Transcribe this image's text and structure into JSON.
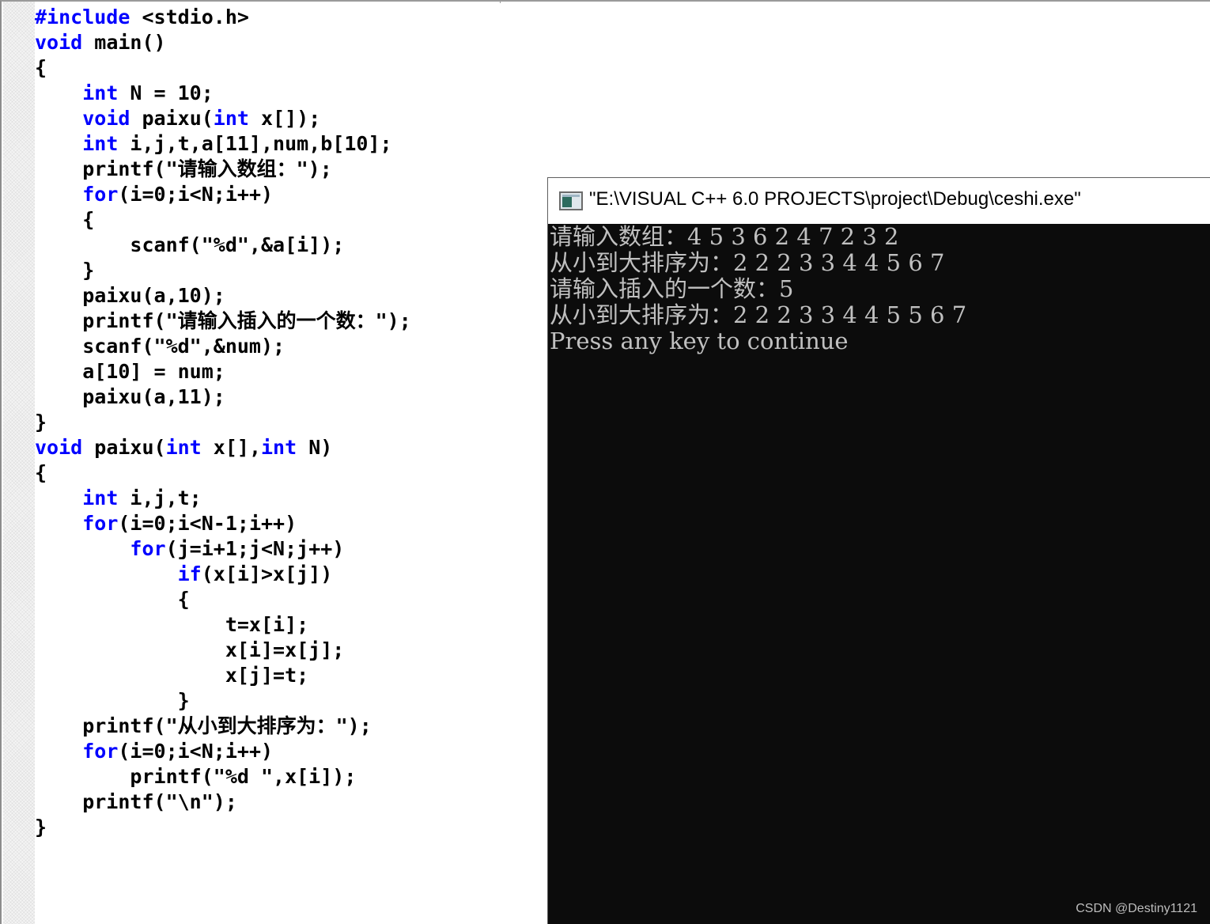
{
  "editor": {
    "code_lines": [
      [
        {
          "t": "#include",
          "k": 1
        },
        {
          "t": " <stdio.h>"
        }
      ],
      [
        {
          "t": "void",
          "k": 1
        },
        {
          "t": " main()"
        }
      ],
      [
        {
          "t": "{"
        }
      ],
      [
        {
          "t": "    "
        },
        {
          "t": "int",
          "k": 1
        },
        {
          "t": " N = 10;"
        }
      ],
      [
        {
          "t": "    "
        },
        {
          "t": "void",
          "k": 1
        },
        {
          "t": " paixu("
        },
        {
          "t": "int",
          "k": 1
        },
        {
          "t": " x[]);"
        }
      ],
      [
        {
          "t": "    "
        },
        {
          "t": "int",
          "k": 1
        },
        {
          "t": " i,j,t,a[11],num,b[10];"
        }
      ],
      [
        {
          "t": "    printf(\"请输入数组：\");"
        }
      ],
      [
        {
          "t": "    "
        },
        {
          "t": "for",
          "k": 1
        },
        {
          "t": "(i=0;i<N;i++)"
        }
      ],
      [
        {
          "t": "    {"
        }
      ],
      [
        {
          "t": "        scanf(\"%d\",&a[i]);"
        }
      ],
      [
        {
          "t": "    }"
        }
      ],
      [
        {
          "t": "    paixu(a,10);"
        }
      ],
      [
        {
          "t": "    printf(\"请输入插入的一个数：\");"
        }
      ],
      [
        {
          "t": "    scanf(\"%d\",&num);"
        }
      ],
      [
        {
          "t": "    a[10] = num;"
        }
      ],
      [
        {
          "t": "    paixu(a,11);"
        }
      ],
      [
        {
          "t": "}"
        }
      ],
      [
        {
          "t": "void",
          "k": 1
        },
        {
          "t": " paixu("
        },
        {
          "t": "int",
          "k": 1
        },
        {
          "t": " x[],"
        },
        {
          "t": "int",
          "k": 1
        },
        {
          "t": " N)"
        }
      ],
      [
        {
          "t": "{"
        }
      ],
      [
        {
          "t": "    "
        },
        {
          "t": "int",
          "k": 1
        },
        {
          "t": " i,j,t;"
        }
      ],
      [
        {
          "t": "    "
        },
        {
          "t": "for",
          "k": 1
        },
        {
          "t": "(i=0;i<N-1;i++)"
        }
      ],
      [
        {
          "t": "        "
        },
        {
          "t": "for",
          "k": 1
        },
        {
          "t": "(j=i+1;j<N;j++)"
        }
      ],
      [
        {
          "t": "            "
        },
        {
          "t": "if",
          "k": 1
        },
        {
          "t": "(x[i]>x[j])"
        }
      ],
      [
        {
          "t": "            {"
        }
      ],
      [
        {
          "t": "                t=x[i];"
        }
      ],
      [
        {
          "t": "                x[i]=x[j];"
        }
      ],
      [
        {
          "t": "                x[j]=t;"
        }
      ],
      [
        {
          "t": "            }"
        }
      ],
      [
        {
          "t": "    printf(\"从小到大排序为：\");"
        }
      ],
      [
        {
          "t": "    "
        },
        {
          "t": "for",
          "k": 1
        },
        {
          "t": "(i=0;i<N;i++)"
        }
      ],
      [
        {
          "t": "        printf(\"%d \",x[i]);"
        }
      ],
      [
        {
          "t": "    printf(\"\\n\");"
        }
      ],
      [
        {
          "t": "}"
        }
      ]
    ],
    "keyword_color": "#0000ff",
    "text_color": "#000000"
  },
  "console": {
    "title": "\"E:\\VISUAL C++ 6.0 PROJECTS\\project\\Debug\\ceshi.exe\"",
    "icon": "console-app-icon",
    "output_lines": [
      "请输入数组：4 5 3 6 2 4 7 2 3 2",
      "从小到大排序为：2 2 2 3 3 4 4 5 6 7",
      "请输入插入的一个数：5",
      "从小到大排序为：2 2 2 3 3 4 4 5 5 6 7",
      "Press any key to continue"
    ],
    "background_color": "#0c0c0c",
    "text_color": "#c0c0c0"
  },
  "watermark": "CSDN @Destiny1121"
}
